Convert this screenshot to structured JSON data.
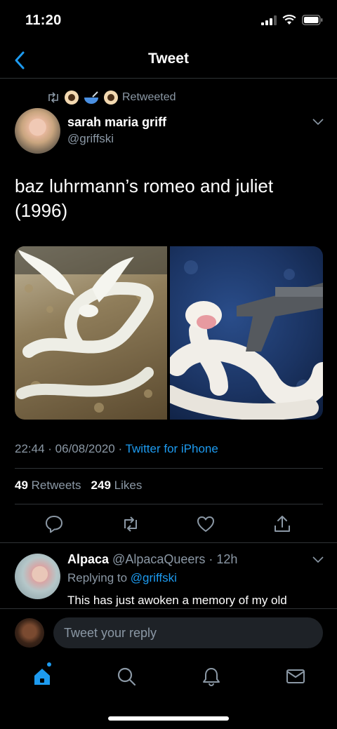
{
  "status_bar": {
    "time": "11:20"
  },
  "nav": {
    "title": "Tweet"
  },
  "retweet_banner": {
    "label": "Retweeted"
  },
  "author": {
    "name": "sarah maria griff",
    "handle": "@griffski"
  },
  "tweet": {
    "text": "baz luhrmann’s romeo and juliet (1996)",
    "time": "22:44",
    "date": "06/08/2020",
    "source": "Twitter for iPhone",
    "separator": " · "
  },
  "stats": {
    "retweets_count": "49",
    "retweets_label": "Retweets",
    "likes_count": "249",
    "likes_label": "Likes"
  },
  "reply": {
    "name": "Alpaca",
    "handle": "@AlpacaQueers",
    "age": "12h",
    "replying_to_label": "Replying to",
    "replying_to_handle": "@griffski",
    "text": "This has just awoken a memory of my old"
  },
  "compose": {
    "placeholder": "Tweet your reply"
  },
  "colors": {
    "accent": "#1d9bf0",
    "muted": "#8b98a5",
    "background": "#000000",
    "divider": "#2f3336"
  },
  "icons": [
    "back-icon",
    "retweet-icon",
    "eye-icon",
    "bowl-icon",
    "chevron-down-icon",
    "reply-icon",
    "retweet-icon",
    "like-icon",
    "share-icon",
    "home-icon",
    "search-icon",
    "notifications-icon",
    "messages-icon"
  ]
}
